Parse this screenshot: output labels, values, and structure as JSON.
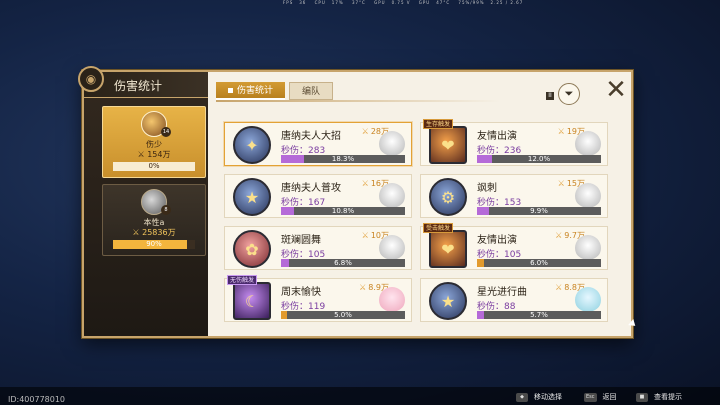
{
  "perf_overlay": {
    "fps_label": "FPS",
    "fps": "36",
    "cpu_label": "CPU",
    "cpu": "17%",
    "temp": "37°C",
    "gpu_label": "GPU",
    "gpu_val": "0.75 V",
    "gpu2_label": "GPU",
    "gpu_temp": "47°C",
    "gpu_load": "75%/99%",
    "mem": "2.25 / 2.67"
  },
  "panel": {
    "title": "伤害统计",
    "close_icon": "close-x-icon",
    "filter_icon": "filter-icon",
    "filter_tag": "II"
  },
  "tabs": [
    {
      "label": "伤害统计",
      "active": true
    },
    {
      "label": "编队",
      "active": false
    }
  ],
  "characters": [
    {
      "name": "伤少",
      "damage": "154万",
      "percent": "0%",
      "fill": 0,
      "level": "14",
      "selected": true
    },
    {
      "name": "本性a",
      "damage": "25836万",
      "percent": "90%",
      "fill": 0.9,
      "level": "8",
      "selected": false
    }
  ],
  "skills": [
    {
      "name": "唐纳夫人大招",
      "total": "28万",
      "dps_label": "秒伤：283",
      "percent": "18.3%",
      "fill": 0.183,
      "tag": "",
      "highlight": true
    },
    {
      "name": "友情出演",
      "total": "19万",
      "dps_label": "秒伤：236",
      "percent": "12.0%",
      "fill": 0.12,
      "tag": "生存触发",
      "highlight": false
    },
    {
      "name": "唐纳夫人普攻",
      "total": "16万",
      "dps_label": "秒伤：167",
      "percent": "10.8%",
      "fill": 0.108,
      "tag": "",
      "highlight": false
    },
    {
      "name": "飒刺",
      "total": "15万",
      "dps_label": "秒伤：153",
      "percent": "9.9%",
      "fill": 0.099,
      "tag": "",
      "highlight": false
    },
    {
      "name": "斑斓圆舞",
      "total": "10万",
      "dps_label": "秒伤：105",
      "percent": "6.8%",
      "fill": 0.068,
      "tag": "",
      "highlight": false
    },
    {
      "name": "友情出演",
      "total": "9.7万",
      "dps_label": "秒伤：105",
      "percent": "6.0%",
      "fill": 0.06,
      "tag": "受击触发",
      "highlight": false
    },
    {
      "name": "周末愉快",
      "total": "8.9万",
      "dps_label": "秒伤：119",
      "percent": "5.0%",
      "fill": 0.05,
      "tag": "无伤触发",
      "highlight": false
    },
    {
      "name": "星光进行曲",
      "total": "8.8万",
      "dps_label": "秒伤：88",
      "percent": "5.7%",
      "fill": 0.057,
      "tag": "",
      "highlight": false
    }
  ],
  "footer": {
    "uid": "ID:400778010",
    "hints": [
      {
        "key": "◆",
        "label": "移动选择"
      },
      {
        "key": "Esc",
        "label": "返回"
      },
      {
        "key": "■",
        "label": "查看提示"
      }
    ]
  }
}
